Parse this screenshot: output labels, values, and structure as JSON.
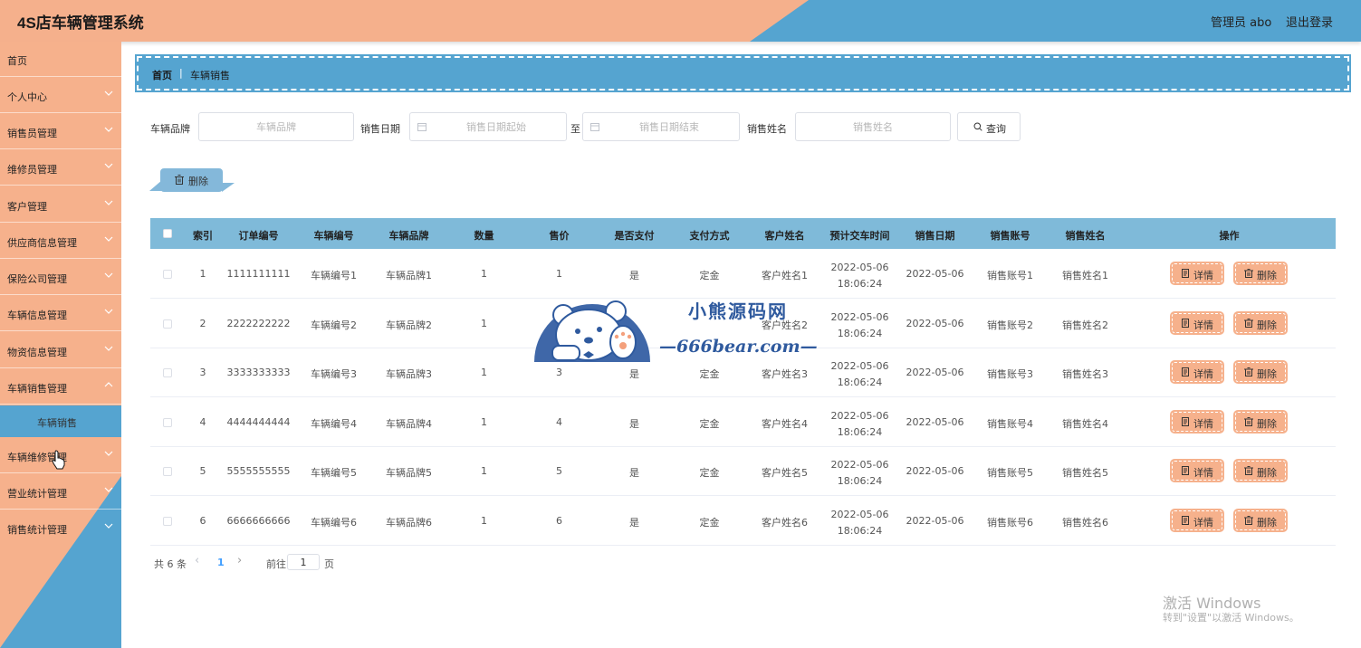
{
  "header": {
    "title": "4S店车辆管理系统",
    "admin": "管理员 abo",
    "logout": "退出登录",
    "colors": {
      "peach": "#f5b08c",
      "blue": "#55a4d0"
    }
  },
  "sidebar": {
    "items": [
      {
        "label": "首页"
      },
      {
        "label": "个人中心"
      },
      {
        "label": "销售员管理"
      },
      {
        "label": "维修员管理"
      },
      {
        "label": "客户管理"
      },
      {
        "label": "供应商信息管理"
      },
      {
        "label": "保险公司管理"
      },
      {
        "label": "车辆信息管理"
      },
      {
        "label": "物资信息管理"
      },
      {
        "label": "车辆销售管理"
      },
      {
        "label": "车辆维修管理"
      },
      {
        "label": "营业统计管理"
      },
      {
        "label": "销售统计管理"
      }
    ],
    "submenu": {
      "label": "车辆销售"
    }
  },
  "breadcrumb": {
    "home": "首页",
    "separator": "|",
    "current": "车辆销售"
  },
  "search": {
    "brand_label": "车辆品牌",
    "brand_placeholder": "车辆品牌",
    "date_label": "销售日期",
    "date_start_placeholder": "销售日期起始",
    "date_to": "至",
    "date_end_placeholder": "销售日期结束",
    "name_label": "销售姓名",
    "name_placeholder": "销售姓名",
    "query_label": "查询"
  },
  "toolbar": {
    "delete_label": "删除"
  },
  "table": {
    "headers": [
      "索引",
      "订单编号",
      "车辆编号",
      "车辆品牌",
      "数量",
      "售价",
      "是否支付",
      "支付方式",
      "客户姓名",
      "预计交车时间",
      "销售日期",
      "销售账号",
      "销售姓名",
      "操作"
    ],
    "rows": [
      {
        "idx": "1",
        "order": "1111111111",
        "car_no": "车辆编号1",
        "brand": "车辆品牌1",
        "qty": "1",
        "price": "1",
        "paid": "是",
        "pay": "定金",
        "customer": "客户姓名1",
        "delivery_date": "2022-05-06",
        "delivery_time": "18:06:24",
        "sale_date": "2022-05-06",
        "account": "销售账号1",
        "seller": "销售姓名1"
      },
      {
        "idx": "2",
        "order": "2222222222",
        "car_no": "车辆编号2",
        "brand": "车辆品牌2",
        "qty": "1",
        "price": "",
        "paid": "",
        "pay": "",
        "customer": "客户姓名2",
        "delivery_date": "2022-05-06",
        "delivery_time": "18:06:24",
        "sale_date": "2022-05-06",
        "account": "销售账号2",
        "seller": "销售姓名2"
      },
      {
        "idx": "3",
        "order": "3333333333",
        "car_no": "车辆编号3",
        "brand": "车辆品牌3",
        "qty": "1",
        "price": "3",
        "paid": "是",
        "pay": "定金",
        "customer": "客户姓名3",
        "delivery_date": "2022-05-06",
        "delivery_time": "18:06:24",
        "sale_date": "2022-05-06",
        "account": "销售账号3",
        "seller": "销售姓名3"
      },
      {
        "idx": "4",
        "order": "4444444444",
        "car_no": "车辆编号4",
        "brand": "车辆品牌4",
        "qty": "1",
        "price": "4",
        "paid": "是",
        "pay": "定金",
        "customer": "客户姓名4",
        "delivery_date": "2022-05-06",
        "delivery_time": "18:06:24",
        "sale_date": "2022-05-06",
        "account": "销售账号4",
        "seller": "销售姓名4"
      },
      {
        "idx": "5",
        "order": "5555555555",
        "car_no": "车辆编号5",
        "brand": "车辆品牌5",
        "qty": "1",
        "price": "5",
        "paid": "是",
        "pay": "定金",
        "customer": "客户姓名5",
        "delivery_date": "2022-05-06",
        "delivery_time": "18:06:24",
        "sale_date": "2022-05-06",
        "account": "销售账号5",
        "seller": "销售姓名5"
      },
      {
        "idx": "6",
        "order": "6666666666",
        "car_no": "车辆编号6",
        "brand": "车辆品牌6",
        "qty": "1",
        "price": "6",
        "paid": "是",
        "pay": "定金",
        "customer": "客户姓名6",
        "delivery_date": "2022-05-06",
        "delivery_time": "18:06:24",
        "sale_date": "2022-05-06",
        "account": "销售账号6",
        "seller": "销售姓名6"
      }
    ],
    "detail_label": "详情",
    "delete_label": "删除"
  },
  "pagination": {
    "total": "共 6 条",
    "current": "1",
    "goto_label": "前往",
    "goto_value": "1",
    "page_label": "页"
  },
  "watermark": {
    "title": "小熊源码网",
    "subtitle": "—666bear.com—"
  },
  "windows": {
    "line1": "激活 Windows",
    "line2": "转到\"设置\"以激活 Windows。"
  }
}
